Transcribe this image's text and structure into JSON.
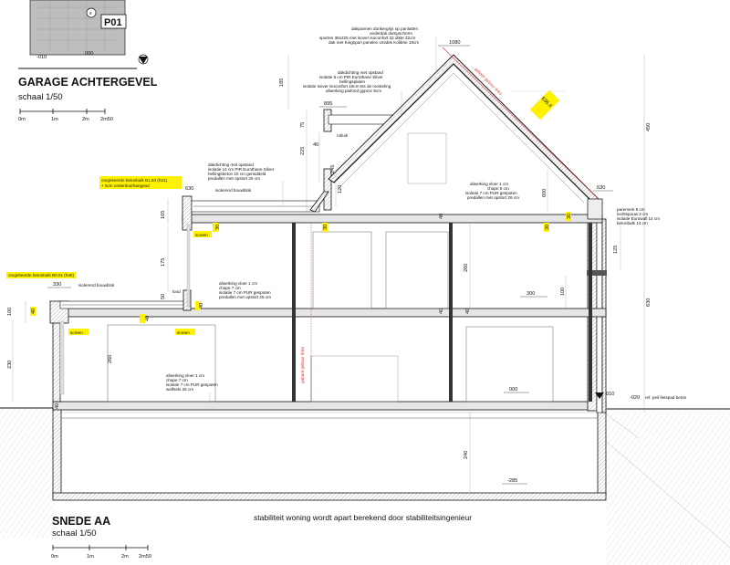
{
  "garage_view": {
    "title": "GARAGE ACHTERGEVEL",
    "scale": "schaal 1/50",
    "tag": "P01",
    "marker": "8",
    "level_left": "-010",
    "level_mid": "000",
    "scalebar": [
      "0m",
      "1m",
      "2m",
      "2m50"
    ]
  },
  "section": {
    "title": "SNEDE AA",
    "scale": "schaal 1/50",
    "scalebar": [
      "0m",
      "1m",
      "2m",
      "2m50"
    ],
    "stability_note": "stabiliteit woning wordt apart berekend door stabiliteitsingenieur"
  },
  "colors": {
    "highlight": "#fff200",
    "gabarit": "#d63b3b",
    "line": "#111111"
  },
  "annotations": {
    "roof_top": [
      "dakpannen donkergrijs op panlatten",
      "onderdak dampscherm",
      "sporten 38x225 met isover isoconfort 32 dikte 22cm",
      "dak met Kingspan panelen Unidek Kolibrie 19cm"
    ],
    "dormer": [
      "dakdichting met opstand",
      "isolatie 6 cm PIR Eurothane Silver",
      "hellingsplaten",
      "isolatie isover isoconfort 18cm tss de roosteling",
      "afwerking plafond gyproc 5cm"
    ],
    "flat_roof_upper": [
      "dakdichting met opstand",
      "isolatie 14 cm PIR Eurothane Silver",
      "hellingsbeton 10 cm gemiddeld",
      "predallen met opstort 25 cm"
    ],
    "beam_b103": [
      "omgekeerde betonbalk B1.03 (h31)",
      "+ 5cm onderdoorhangend"
    ],
    "isolerend_upper": "isolerend bouwblok",
    "floor_upper": [
      "afwerking vloer 1 cm",
      "chape  6 cm",
      "isolatie 7 cm PUR gespoten",
      "predallen met opstort 26 cm"
    ],
    "wall_right": [
      "parement 9 cm",
      "luchtspouw 2 cm",
      "isolatie Eurowall  14 cm",
      "betonbalk 14 cm"
    ],
    "beam_b001": "omgekeerde betonbalk B0.01 (h40)",
    "isolerend_lower": "isolerend bouwblok",
    "floor_mid": [
      "afwerking vloer 1 cm",
      "chape  7 cm",
      "isolatie 7 cm PUR gespoten",
      "predallen met opstort 25 cm"
    ],
    "floor_ground": [
      "afwerking vloer 1 cm",
      "chape  7 cm",
      "isolatie 7 cm PUR gespoten",
      "welfsels 25 cm"
    ],
    "rolluik": "rolluik",
    "lood": "lood",
    "screen": "screen",
    "gabarit": "gabarit gebuur links",
    "ref_peil": "ref. peil fietspad beton"
  },
  "levels": {
    "l1080": "1080",
    "l895": "895",
    "l630": "630",
    "l630r": "630",
    "l330": "330",
    "l300": "300",
    "l000": "000",
    "l010": "010",
    "lm020": "-020",
    "lm285": "-285"
  },
  "dims": {
    "d185": "185",
    "d75": "75",
    "d40a": "40",
    "d225": "225",
    "d245": "245",
    "d120": "120",
    "d105": "105",
    "d30a": "30",
    "d175": "175",
    "d50": "50",
    "d40b": "40",
    "d100": "100",
    "d230": "230",
    "d260a": "260",
    "d260b": "260",
    "d240": "240",
    "d450": "450",
    "d6364": "636,4",
    "d600": "600",
    "d125": "125",
    "d630": "630",
    "d100b": "100",
    "d40c": "40",
    "d40d": "40",
    "d30b": "30",
    "d30c": "30",
    "d30d": "30",
    "d40e": "40",
    "d40f": "40",
    "d40g": "40",
    "d40h": "40"
  }
}
